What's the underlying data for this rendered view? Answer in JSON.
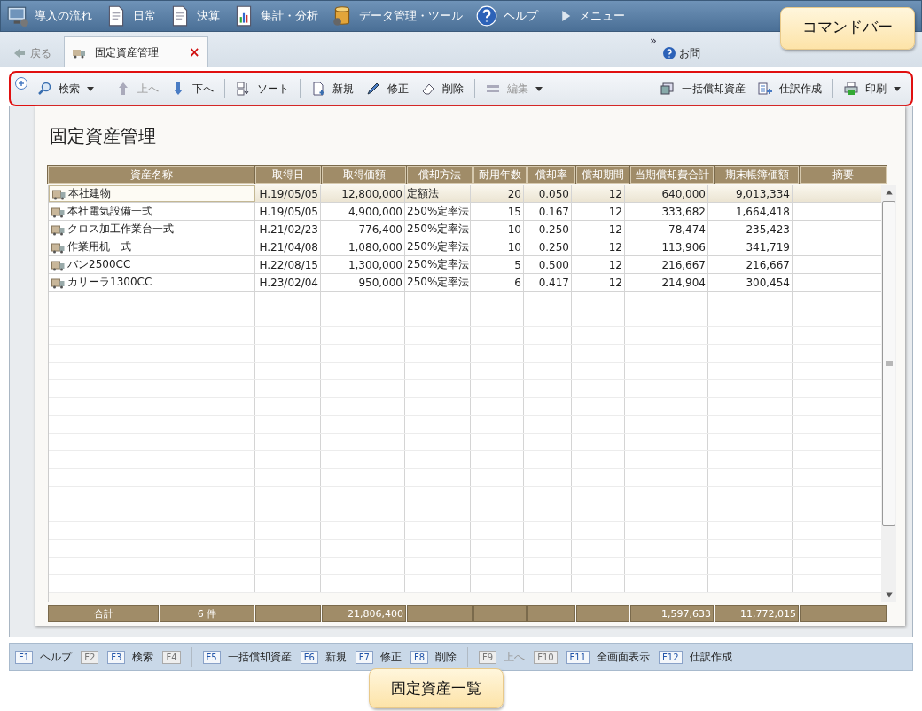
{
  "menu_bar": [
    {
      "label": "導入の流れ"
    },
    {
      "label": "日常"
    },
    {
      "label": "決算"
    },
    {
      "label": "集計・分析"
    },
    {
      "label": "データ管理・ツール"
    },
    {
      "label": "ヘルプ"
    },
    {
      "label": "メニュー"
    }
  ],
  "tab_bar": {
    "back": {
      "label": "戻る",
      "disabled": true
    },
    "tabs": [
      {
        "label": "固定資産管理",
        "selected": true,
        "close": "×"
      }
    ],
    "overflow": "»",
    "help": {
      "label": "お問"
    }
  },
  "toolbar": {
    "left": [
      {
        "label": "検索",
        "disabled": false,
        "dropdown": true
      },
      {
        "label": "上へ",
        "disabled": true,
        "dropdown": false
      },
      {
        "label": "下へ",
        "disabled": false,
        "dropdown": false
      },
      {
        "label": "ソート",
        "disabled": false,
        "dropdown": false
      },
      {
        "label": "新規",
        "disabled": false,
        "dropdown": false
      },
      {
        "label": "修正",
        "disabled": false,
        "dropdown": false
      },
      {
        "label": "削除",
        "disabled": false,
        "dropdown": false
      },
      {
        "label": "編集",
        "disabled": true,
        "dropdown": true
      }
    ],
    "right": [
      {
        "label": "一括償却資産",
        "disabled": false,
        "dropdown": false
      },
      {
        "label": "仕訳作成",
        "disabled": false,
        "dropdown": false
      },
      {
        "label": "印刷",
        "disabled": false,
        "dropdown": true
      }
    ]
  },
  "page_title": "固定資産管理",
  "table": {
    "columns": [
      "資産名称",
      "取得日",
      "取得価額",
      "償却方法",
      "耐用年数",
      "償却率",
      "償却期間",
      "当期償却費合計",
      "期末帳簿価額",
      "摘要"
    ],
    "rows": [
      {
        "selected": true,
        "cells": [
          "本社建物",
          "H.19/05/05",
          "12,800,000",
          "定額法",
          "20",
          "0.050",
          "12",
          "640,000",
          "9,013,334"
        ]
      },
      {
        "selected": false,
        "cells": [
          "本社電気設備一式",
          "H.19/05/05",
          "4,900,000",
          "250%定率法",
          "15",
          "0.167",
          "12",
          "333,682",
          "1,664,418"
        ]
      },
      {
        "selected": false,
        "cells": [
          "クロス加工作業台一式",
          "H.21/02/23",
          "776,400",
          "250%定率法",
          "10",
          "0.250",
          "12",
          "78,474",
          "235,423"
        ]
      },
      {
        "selected": false,
        "cells": [
          "作業用机一式",
          "H.21/04/08",
          "1,080,000",
          "250%定率法",
          "10",
          "0.250",
          "12",
          "113,906",
          "341,719"
        ]
      },
      {
        "selected": false,
        "cells": [
          "バン2500CC",
          "H.22/08/15",
          "1,300,000",
          "250%定率法",
          "5",
          "0.500",
          "12",
          "216,667",
          "216,667"
        ]
      },
      {
        "selected": false,
        "cells": [
          "カリーラ1300CC",
          "H.23/02/04",
          "950,000",
          "250%定率法",
          "6",
          "0.417",
          "12",
          "214,904",
          "300,454"
        ]
      }
    ],
    "totals": {
      "label": "合計",
      "count": "6 件",
      "acquisition": "21,806,400",
      "depreciation": "1,597,633",
      "book_value": "11,772,015"
    }
  },
  "function_keys": [
    {
      "key": "F1",
      "label": "ヘルプ",
      "disabled": false
    },
    {
      "key": "F2",
      "disabled": true
    },
    {
      "key": "F3",
      "label": "検索",
      "disabled": false
    },
    {
      "key": "F4",
      "disabled": true
    },
    {
      "key": "F5",
      "label": "一括償却資産",
      "disabled": false
    },
    {
      "key": "F6",
      "label": "新規",
      "disabled": false
    },
    {
      "key": "F7",
      "label": "修正",
      "disabled": false
    },
    {
      "key": "F8",
      "label": "削除",
      "disabled": false
    },
    {
      "key": "F9",
      "label": "上へ",
      "disabled": true
    },
    {
      "key": "F10",
      "disabled": true
    },
    {
      "key": "F11",
      "label": "全画面表示",
      "disabled": false
    },
    {
      "key": "F12",
      "label": "仕訳作成",
      "disabled": false
    }
  ],
  "callouts": [
    {
      "text": "コマンドバー"
    },
    {
      "text": "固定資産一覧"
    }
  ]
}
